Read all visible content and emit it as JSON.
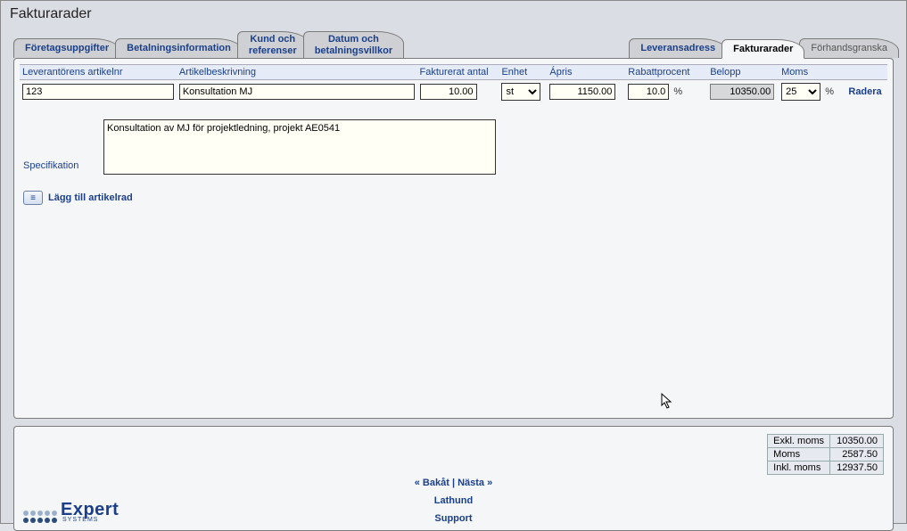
{
  "title": "Fakturarader",
  "tabs": {
    "t0": "Företagsuppgifter",
    "t1": "Betalningsinformation",
    "t2": "Kund och\nreferenser",
    "t3": "Datum och\nbetalningsvillkor",
    "t4": "Leveransadress",
    "t5": "Fakturarader",
    "t6": "Förhandsgranska"
  },
  "columns": {
    "article_no": "Leverantörens artikelnr",
    "description": "Artikelbeskrivning",
    "qty": "Fakturerat antal",
    "unit": "Enhet",
    "price": "Ápris",
    "discount": "Rabattprocent",
    "amount": "Belopp",
    "vat": "Moms",
    "delete": "Radera"
  },
  "row": {
    "article_no": "123",
    "description": "Konsultation MJ",
    "qty": "10.00",
    "unit": "st",
    "price": "1150.00",
    "discount": "10.0",
    "amount": "10350.00",
    "vat": "25",
    "pct": "%"
  },
  "spec": {
    "label": "Specifikation",
    "text": "Konsultation av MJ för projektledning, projekt AE0541"
  },
  "add_label": "Lägg till artikelrad",
  "totals": {
    "excl_label": "Exkl. moms",
    "excl_val": "10350.00",
    "vat_label": "Moms",
    "vat_val": "2587.50",
    "incl_label": "Inkl. moms",
    "incl_val": "12937.50"
  },
  "nav": {
    "back": "« Bakåt",
    "sep": " | ",
    "next": "Nästa »",
    "help": "Lathund",
    "support": "Support"
  },
  "logo": {
    "brand": "Expert",
    "sub": "SYSTEMS"
  }
}
